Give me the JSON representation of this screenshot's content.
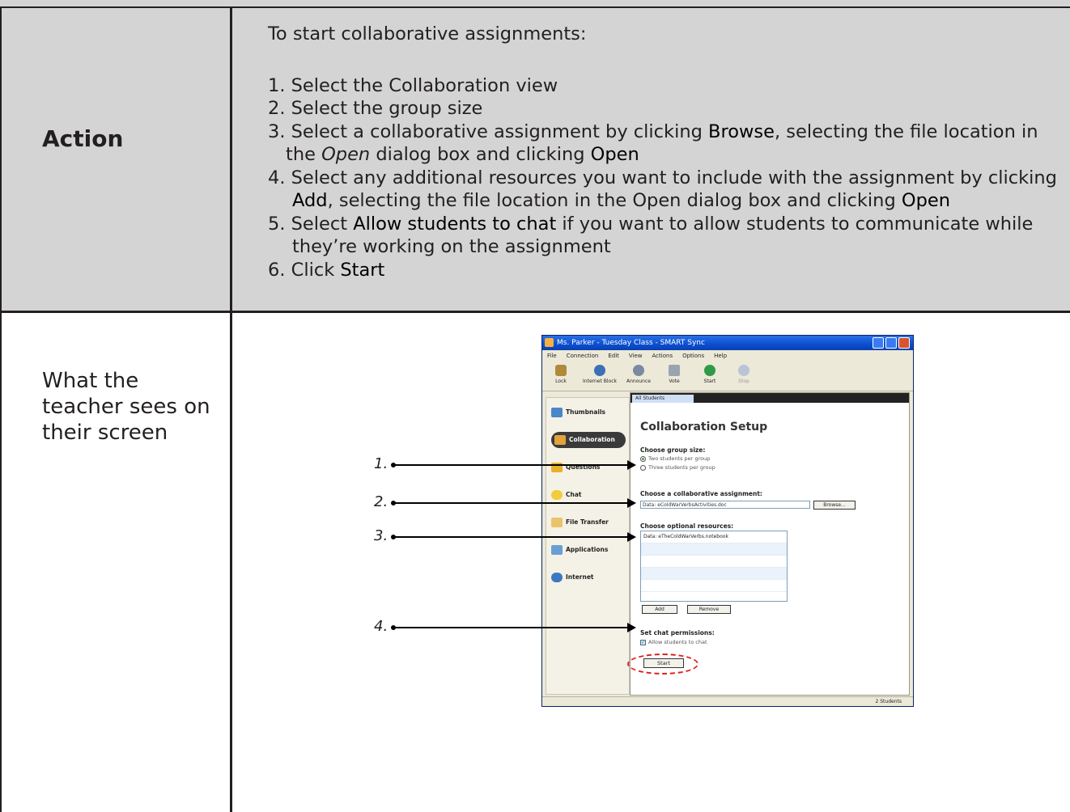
{
  "action": {
    "label": "Action",
    "heading": "To start collaborative assignments:",
    "steps": [
      {
        "l1a": "1. Select the Collaboration view"
      },
      {
        "l1a": "2. Select the group size"
      },
      {
        "l1a": "3. Select a collaborative assignment by clicking ",
        "l1b": "Browse",
        "l1c": ", selecting the file location in",
        "l2a": "the ",
        "l2b": "Open",
        "l2c": " dialog box and clicking ",
        "l2d": "Open"
      },
      {
        "l1a": "4. Select any additional resources you want to include with the assignment by clicking",
        "l2a": "Add",
        "l2b": ", selecting the file location in the Open dialog box and clicking ",
        "l2c": "Open"
      },
      {
        "l1a": "5. Select ",
        "l1b": "Allow students to chat",
        "l1c": " if you want to allow students to communicate while",
        "l2a": "they’re working on the assignment"
      },
      {
        "l1a": "6. Click ",
        "l1b": "Start"
      }
    ]
  },
  "teacher": {
    "label": "What the teacher sees on their screen"
  },
  "callouts": [
    "1.",
    "2.",
    "3.",
    "4."
  ],
  "app": {
    "title": "Ms. Parker - Tuesday Class - SMART Sync",
    "menu": [
      "File",
      "Connection",
      "Edit",
      "View",
      "Actions",
      "Options",
      "Help"
    ],
    "toolbar": [
      "Lock",
      "Internet Block",
      "Announce",
      "Vote",
      "Start",
      "Stop"
    ],
    "sidebar": [
      "Thumbnails",
      "Collaboration",
      "Questions",
      "Chat",
      "File Transfer",
      "Applications",
      "Internet"
    ],
    "tab": "All Students",
    "setup_title": "Collaboration Setup",
    "group_size_label": "Choose group size:",
    "group_opt1": "Two students per group",
    "group_opt2": "Three students per group",
    "assignment_label": "Choose a collaborative assignment:",
    "assignment_value": "Data: eColdWarVerbsActivities.doc",
    "browse_label": "Browse...",
    "resources_label": "Choose optional resources:",
    "resource_item": "Data: eTheColdWarVerbs.notebook",
    "add_label": "Add",
    "remove_label": "Remove",
    "chat_label": "Set chat permissions:",
    "chat_opt": "Allow students to chat",
    "start_label": "Start",
    "status": "2 Students",
    "colors": {
      "title_blue": "#0a4fd1",
      "highlight_red": "#e02020"
    }
  }
}
